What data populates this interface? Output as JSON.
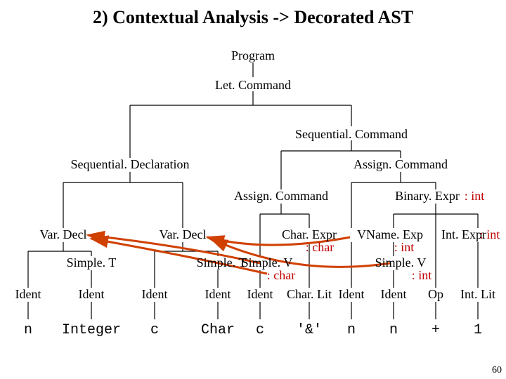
{
  "title": "2) Contextual Analysis -> Decorated AST",
  "page_number": "60",
  "nodes": {
    "program": "Program",
    "letcmd": "Let. Command",
    "seqcmd": "Sequential. Command",
    "seqdecl": "Sequential. Declaration",
    "assign1": "Assign. Command",
    "assign2": "Assign. Command",
    "binexpr": "Binary. Expr",
    "vardecl1": "Var. Decl",
    "vardecl2": "Var. Decl",
    "charexpr": "Char. Expr",
    "vnameexp": "VName. Exp",
    "intexpr": "Int. Expr",
    "simplet1": "Simple. T",
    "simplet2": "Simple. T",
    "simplev1": "Simple. V",
    "simplev2": "Simple. V",
    "ident": "Ident",
    "charlit": "Char. Lit",
    "op": "Op",
    "intlit": "Int. Lit"
  },
  "types": {
    "int": ": int",
    "char": ": char"
  },
  "leaves": {
    "n": "n",
    "integer": "Integer",
    "c": "c",
    "char": "Char",
    "amp": "'&'",
    "plus": "+",
    "one": "1"
  }
}
